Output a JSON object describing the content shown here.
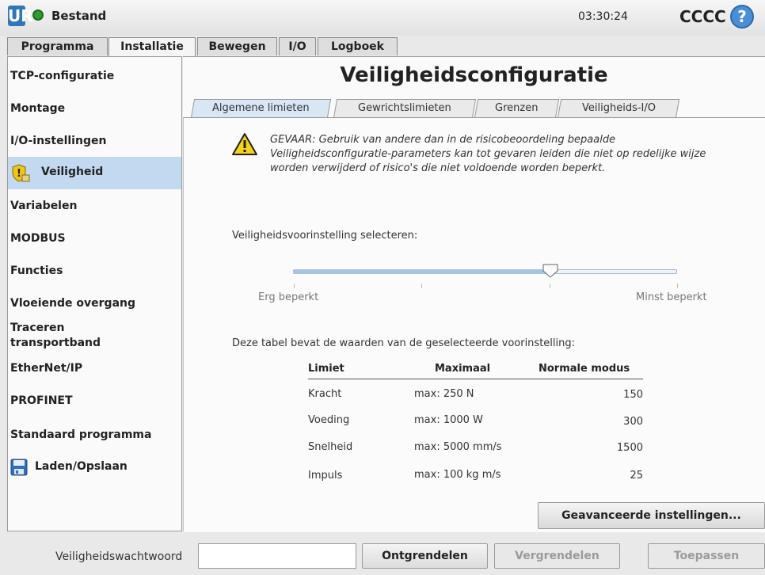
{
  "titlebar": {
    "logo": "UR",
    "status_icon": "green-status-dot",
    "title": "Bestand",
    "clock": "03:30:24",
    "robot_name": "CCCC",
    "help": "?"
  },
  "main_tabs": [
    {
      "label": "Programma",
      "active": false
    },
    {
      "label": "Installatie",
      "active": true
    },
    {
      "label": "Bewegen",
      "active": false
    },
    {
      "label": "I/O",
      "active": false
    },
    {
      "label": "Logboek",
      "active": false
    }
  ],
  "sidebar": {
    "items": [
      {
        "label": "TCP-configuratie"
      },
      {
        "label": "Montage"
      },
      {
        "label": "I/O-instellingen"
      },
      {
        "label": "Veiligheid",
        "icon": "shield-lock-icon",
        "active": true
      },
      {
        "label": "Variabelen"
      },
      {
        "label": "MODBUS"
      },
      {
        "label": "Functies"
      },
      {
        "label": "Vloeiende overgang"
      },
      {
        "label": "Traceren transportband"
      },
      {
        "label": "EtherNet/IP"
      },
      {
        "label": "PROFINET"
      },
      {
        "label": "Standaard programma"
      },
      {
        "label": "Laden/Opslaan",
        "icon": "floppy-disk-icon"
      }
    ]
  },
  "page": {
    "title": "Veiligheidsconfiguratie",
    "subtabs": [
      {
        "label": "Algemene limieten",
        "active": true
      },
      {
        "label": "Gewrichtslimieten",
        "active": false
      },
      {
        "label": "Grenzen",
        "active": false
      },
      {
        "label": "Veiligheids-I/O",
        "active": false
      }
    ],
    "warning": "GEVAAR: Gebruik van andere dan in de risicobeoordeling bepaalde Veiligheidsconfiguratie-parameters kan tot gevaren leiden die niet op redelijke wijze worden verwijderd of risico's die niet voldoende worden beperkt.",
    "preset_label": "Veiligheidsvoorinstelling selecteren:",
    "slider": {
      "min_label": "Erg beperkt",
      "max_label": "Minst beperkt",
      "level_fraction": 0.67
    },
    "table_intro": "Deze tabel bevat de waarden van de geselecteerde voorinstelling:",
    "table": {
      "headers": [
        "Limiet",
        "Maximaal",
        "Normale modus"
      ],
      "rows": [
        [
          "Kracht",
          "max: 250 N",
          "150"
        ],
        [
          "Voeding",
          "max: 1000 W",
          "300"
        ],
        [
          "Snelheid",
          "max: 5000 mm/s",
          "1500"
        ],
        [
          "Impuls",
          "max: 100 kg m/s",
          "25"
        ]
      ]
    },
    "advanced_button": "Geavanceerde instellingen..."
  },
  "bottom": {
    "password_label": "Veiligheidswachtwoord",
    "password_value": "",
    "unlock": "Ontgrendelen",
    "lock": "Vergrendelen",
    "apply": "Toepassen"
  },
  "colors": {
    "active_bg": "#c3d9ef",
    "slider_fill": "#a8c4e2",
    "warning": "#f2d21b",
    "status_ok": "#2e9b2e"
  }
}
